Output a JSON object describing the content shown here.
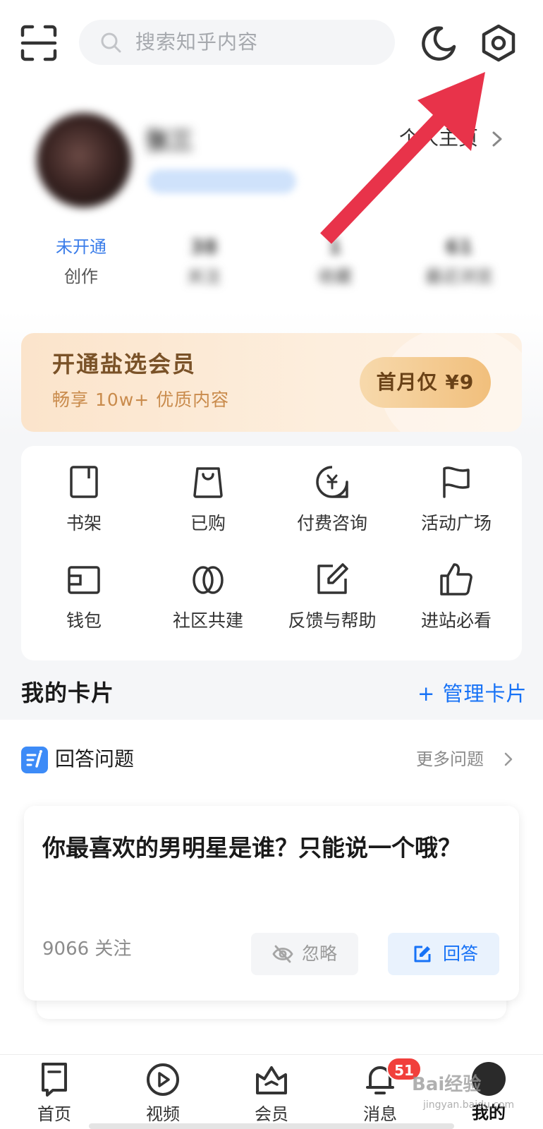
{
  "search": {
    "placeholder": "搜索知乎内容"
  },
  "profile": {
    "name": "张三",
    "badge": "",
    "homepage_label": "个人主页"
  },
  "stats": [
    {
      "value": "未开通",
      "label": "创作"
    },
    {
      "value": "38",
      "label": "关注"
    },
    {
      "value": "1",
      "label": "收藏"
    },
    {
      "value": "61",
      "label": "最近浏览"
    }
  ],
  "vip": {
    "title": "开通盐选会员",
    "subtitle": "畅享 10w+ 优质内容",
    "button": "首月仅 ¥9"
  },
  "grid": [
    {
      "label": "书架",
      "icon": "bookshelf-icon"
    },
    {
      "label": "已购",
      "icon": "bag-icon"
    },
    {
      "label": "付费咨询",
      "icon": "paid-consult-icon"
    },
    {
      "label": "活动广场",
      "icon": "flag-icon"
    },
    {
      "label": "钱包",
      "icon": "wallet-icon"
    },
    {
      "label": "社区共建",
      "icon": "community-icon"
    },
    {
      "label": "反馈与帮助",
      "icon": "feedback-icon"
    },
    {
      "label": "进站必看",
      "icon": "thumbs-up-icon"
    }
  ],
  "cards": {
    "title": "我的卡片",
    "manage": "+ 管理卡片"
  },
  "answer_card": {
    "title": "回答问题",
    "more": "更多问题",
    "question": "你最喜欢的男明星是谁？只能说一个哦？",
    "follow_count": "9066 关注",
    "ignore": "忽略",
    "answer": "回答"
  },
  "nav": [
    {
      "label": "首页",
      "icon": "home-icon"
    },
    {
      "label": "视频",
      "icon": "video-icon"
    },
    {
      "label": "会员",
      "icon": "crown-icon"
    },
    {
      "label": "消息",
      "icon": "bell-icon"
    },
    {
      "label": "我的",
      "icon": "me-avatar"
    }
  ],
  "badge": {
    "messages": "51"
  },
  "watermark": {
    "text": "Bai经验",
    "sub": "jingyan.baidu.com"
  },
  "colors": {
    "accent": "#1772f6",
    "arrow": "#e8334a",
    "badge": "#f1403c",
    "vip_text": "#7a5228"
  }
}
